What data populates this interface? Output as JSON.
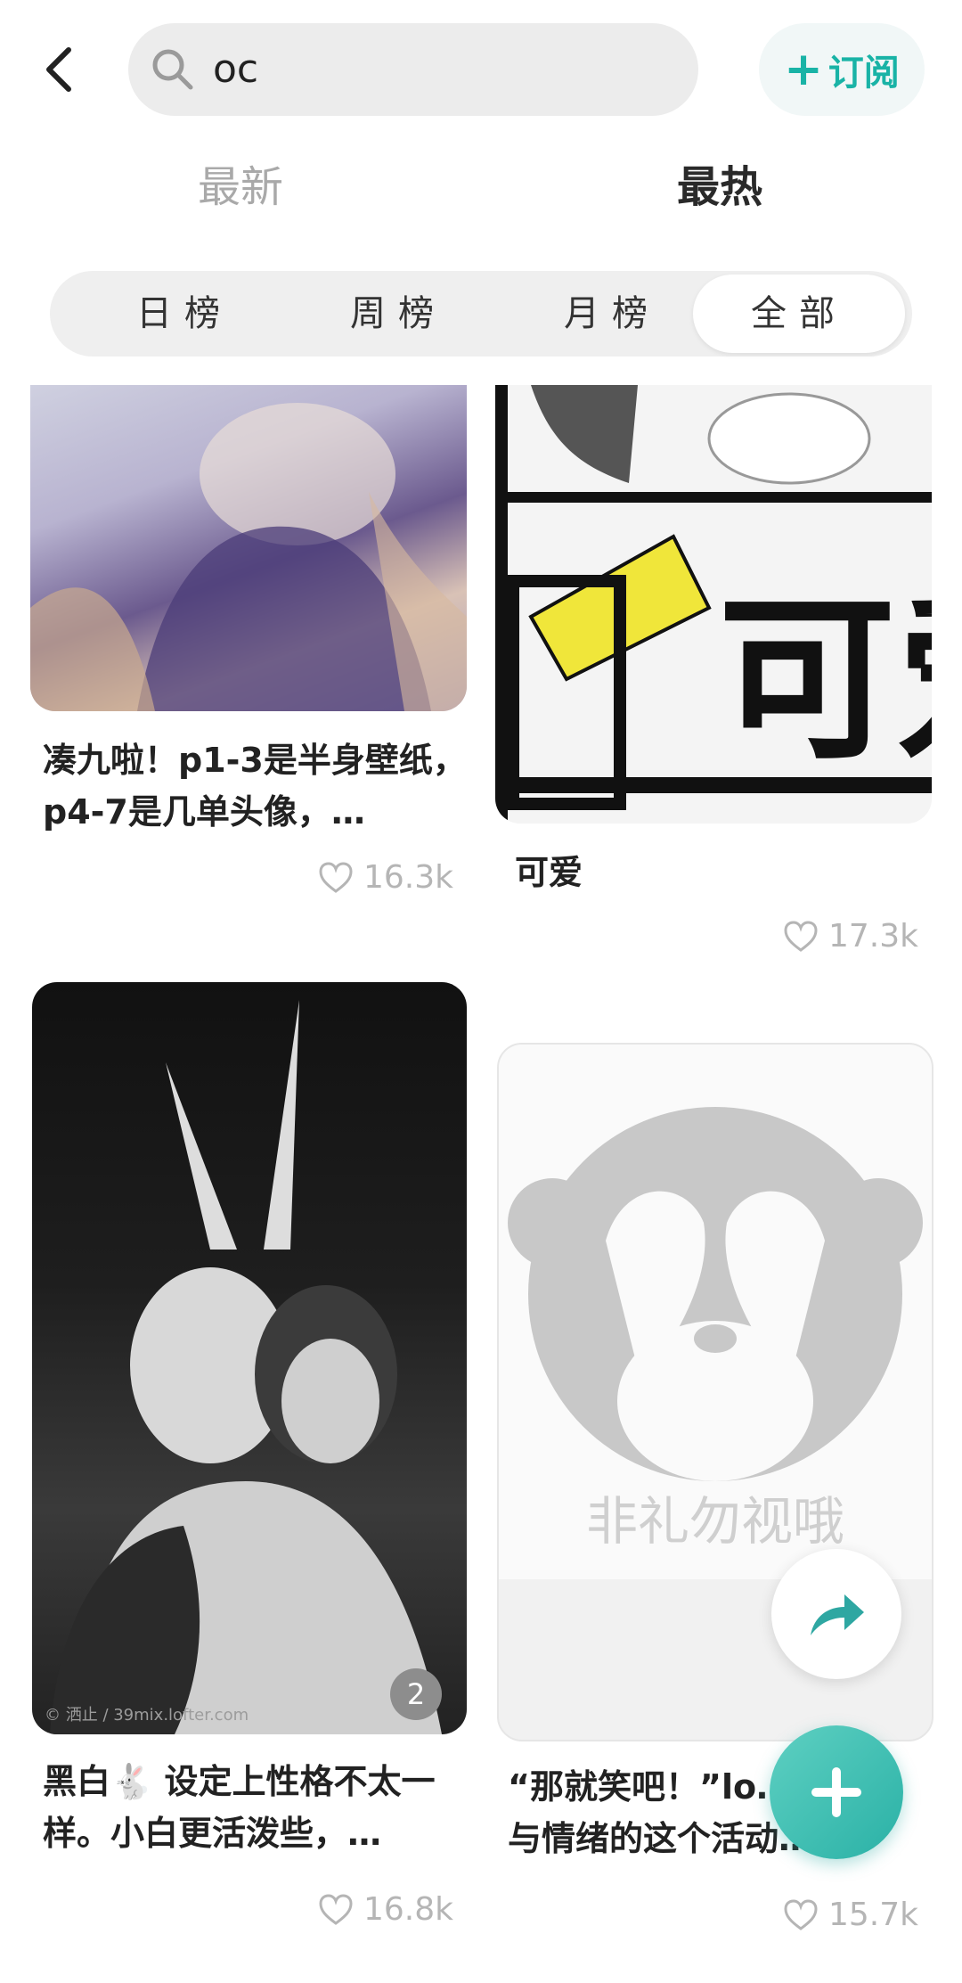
{
  "search": {
    "query": "oc"
  },
  "header": {
    "subscribe_label": "订阅"
  },
  "tabs": [
    {
      "label": "最新"
    },
    {
      "label": "最热"
    }
  ],
  "ranking": [
    {
      "label": "日榜"
    },
    {
      "label": "周榜"
    },
    {
      "label": "月榜"
    },
    {
      "label": "全部"
    }
  ],
  "posts": [
    {
      "title": "凑九啦！p1-3是半身壁纸，p4-7是几单头像，…",
      "likes": "16.3k"
    },
    {
      "title": "可爱",
      "likes": "17.3k",
      "image_text": "可爱"
    },
    {
      "title": "黑白🐇 设定上性格不太一样。小白更活泼些，…",
      "likes": "16.8k",
      "badge": "2",
      "watermark": "© 洒止 / 39mix.lofter.com"
    },
    {
      "title": "“那就笑吧！”lo…室人类与情绪的这个活动…",
      "likes": "15.7k",
      "image_text": "非礼勿视哦"
    }
  ],
  "colors": {
    "accent": "#19b3a6",
    "fab": "#2ab1a6",
    "muted": "#b5b5b5"
  }
}
